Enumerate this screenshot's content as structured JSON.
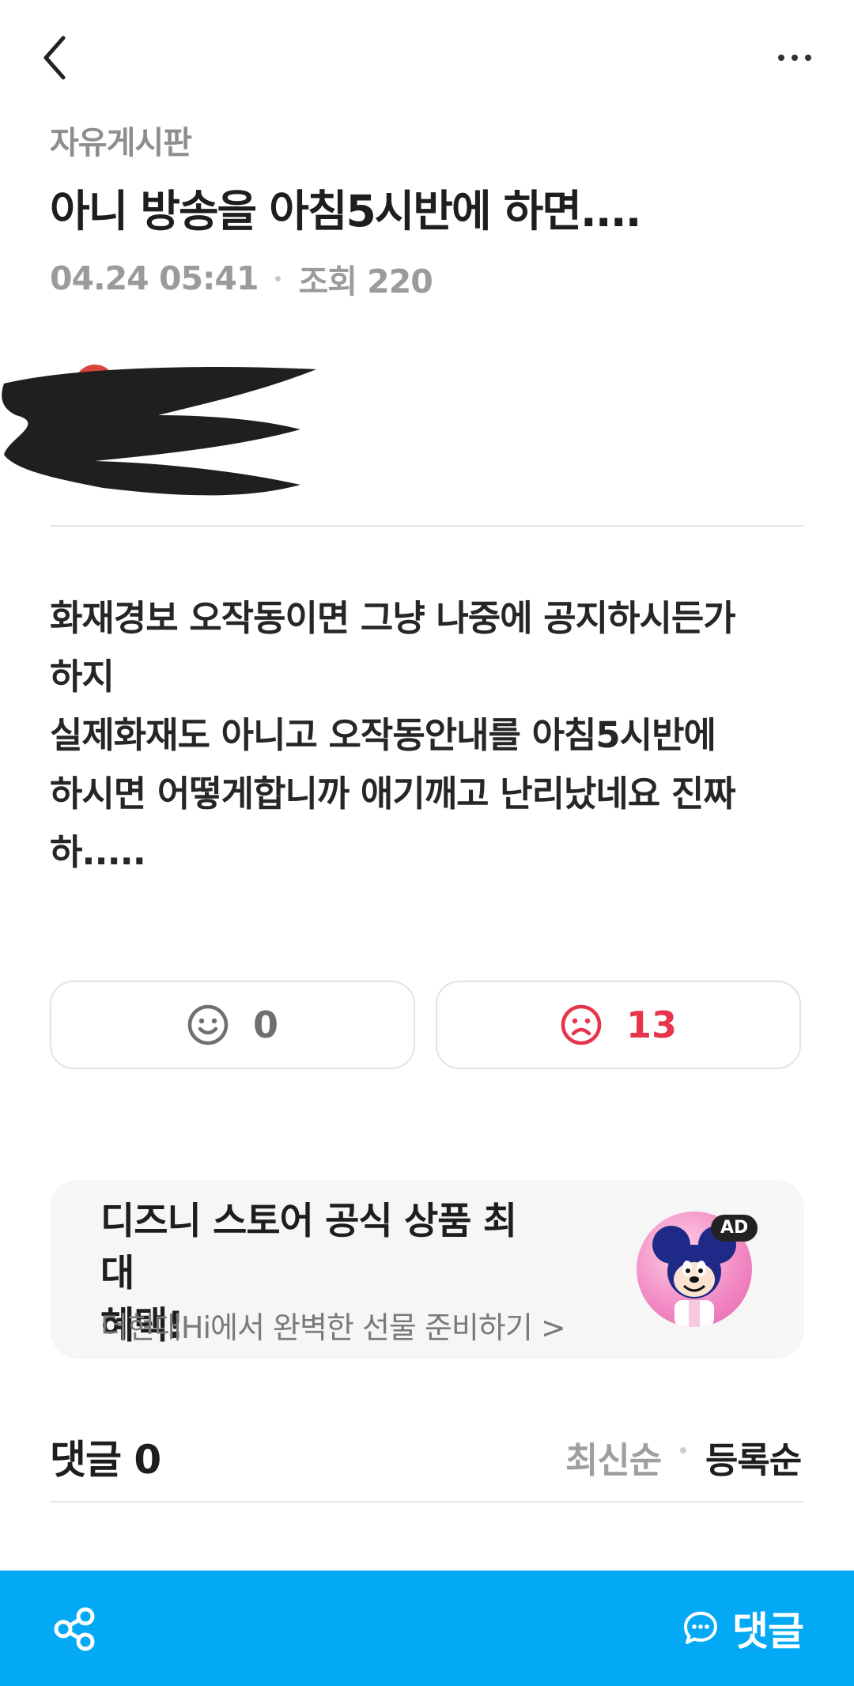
{
  "header": {
    "back_icon": "chevron-left-icon",
    "more_icon": "more-horizontal-icon"
  },
  "post": {
    "category": "자유게시판",
    "title": "아니 방송을 아침5시반에 하면....",
    "date": "04.24 05:41",
    "views": "조회 220",
    "body_lines": [
      "화재경보 오작동이면 그냥 나중에 공지하시든가",
      "하지",
      "실제화재도 아니고 오작동안내를 아침5시반에",
      "하시면 어떻게합니까 애기깨고 난리났네요 진짜",
      "하....."
    ]
  },
  "reactions": {
    "like_count": "0",
    "dislike_count": "13",
    "like_icon": "smile-icon",
    "dislike_icon": "frown-icon",
    "dislike_color": "#e8344b"
  },
  "ad": {
    "title_line1": "디즈니 스토어 공식 상품 최대",
    "title_line2": "혜택!",
    "subtitle": "더현대Hi에서 완벽한 선물 준비하기 >",
    "badge": "AD",
    "image_icon": "mickey-mouse-icon"
  },
  "comments": {
    "title": "댓글 0",
    "sort_latest": "최신순",
    "sort_registered": "등록순"
  },
  "bottom_bar": {
    "color": "#03a9f4",
    "share_icon": "share-icon",
    "comment_icon": "chat-bubble-icon",
    "comment_label": "댓글"
  }
}
